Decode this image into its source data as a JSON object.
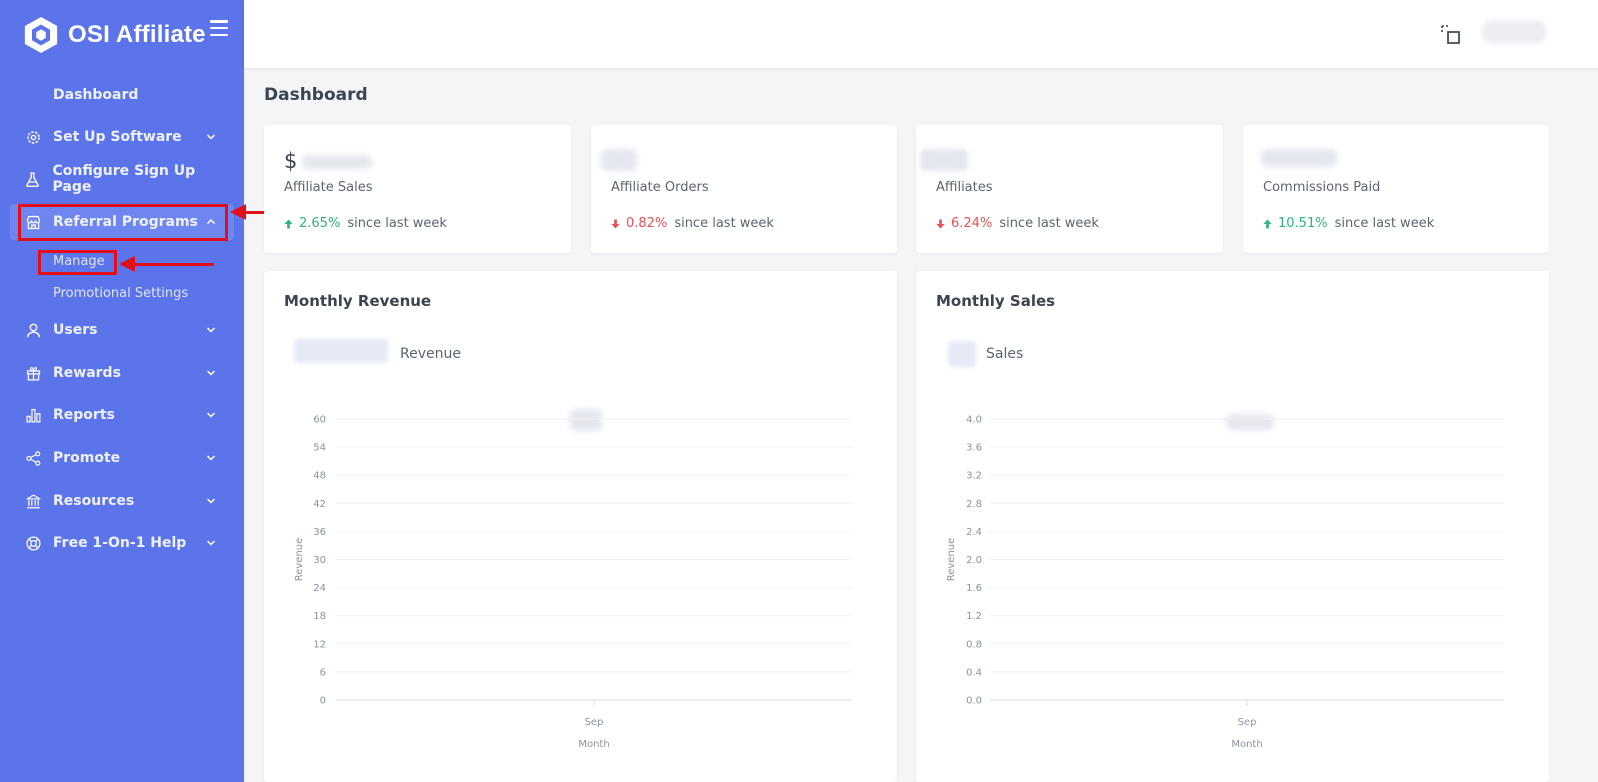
{
  "brand": {
    "name": "OSI Affiliate"
  },
  "sidebar": {
    "items": [
      {
        "label": "Dashboard",
        "icon": "none"
      },
      {
        "label": "Set Up Software",
        "icon": "gear-icon"
      },
      {
        "label": "Configure Sign Up Page",
        "icon": "flask-icon"
      },
      {
        "label": "Referral Programs",
        "icon": "store-icon",
        "expanded": true
      },
      {
        "label": "Users",
        "icon": "user-icon"
      },
      {
        "label": "Rewards",
        "icon": "gift-icon"
      },
      {
        "label": "Reports",
        "icon": "bar-chart-icon"
      },
      {
        "label": "Promote",
        "icon": "share-icon"
      },
      {
        "label": "Resources",
        "icon": "bank-icon"
      },
      {
        "label": "Free 1-On-1 Help",
        "icon": "lifebuoy-icon"
      }
    ],
    "sub_items": [
      {
        "label": "Manage"
      },
      {
        "label": "Promotional Settings"
      }
    ]
  },
  "page": {
    "title": "Dashboard"
  },
  "stats": [
    {
      "value": "$",
      "label": "Affiliate Sales",
      "change": "2.65%",
      "direction": "up",
      "suffix": "since last week"
    },
    {
      "value": "",
      "label": "Affiliate Orders",
      "change": "0.82%",
      "direction": "down",
      "suffix": "since last week"
    },
    {
      "value": "",
      "label": "Affiliates",
      "change": "6.24%",
      "direction": "down",
      "suffix": "since last week"
    },
    {
      "value": "",
      "label": "Commissions Paid",
      "change": "10.51%",
      "direction": "up",
      "suffix": "since last week"
    }
  ],
  "colors": {
    "sidebar_bg": "#5b74ea",
    "up": "#2fb380",
    "down": "#e8505b",
    "annotation": "#e3101b"
  },
  "chart_data": [
    {
      "type": "bar",
      "title": "Monthly Revenue",
      "legend": "Revenue",
      "categories": [
        "Sep"
      ],
      "values": [
        null
      ],
      "xlabel": "Month",
      "ylabel": "Revenue",
      "ylim": [
        0,
        60
      ],
      "yticks": [
        "0",
        "6",
        "12",
        "18",
        "24",
        "30",
        "36",
        "42",
        "48",
        "54",
        "60"
      ],
      "grid": true
    },
    {
      "type": "bar",
      "title": "Monthly Sales",
      "legend": "Sales",
      "categories": [
        "Sep"
      ],
      "values": [
        null
      ],
      "xlabel": "Month",
      "ylabel": "Revenue",
      "ylim": [
        0,
        4
      ],
      "yticks": [
        "0.0",
        "0.4",
        "0.8",
        "1.2",
        "1.6",
        "2.0",
        "2.4",
        "2.8",
        "3.2",
        "3.6",
        "4.0"
      ],
      "grid": true
    }
  ]
}
